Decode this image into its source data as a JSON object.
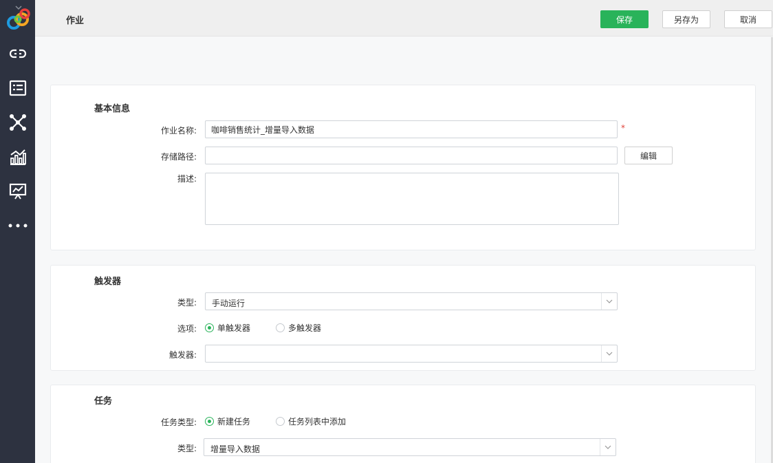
{
  "sidebar": {
    "logo": "app-logo",
    "items": [
      {
        "icon": "link-icon"
      },
      {
        "icon": "list-icon"
      },
      {
        "icon": "network-icon"
      },
      {
        "icon": "chart-icon"
      },
      {
        "icon": "presentation-icon"
      },
      {
        "icon": "more-icon"
      }
    ]
  },
  "header": {
    "title": "作业",
    "save_label": "保存",
    "save_as_label": "另存为",
    "cancel_label": "取消"
  },
  "basic": {
    "title": "基本信息",
    "name_label": "作业名称:",
    "name_value": "咖啡销售统计_增量导入数据",
    "required_mark": "*",
    "path_label": "存储路径:",
    "path_value": "",
    "edit_label": "编辑",
    "desc_label": "描述:"
  },
  "trigger": {
    "title": "触发器",
    "type_label": "类型:",
    "type_value": "手动运行",
    "option_label": "选项:",
    "option_single": "单触发器",
    "option_multi": "多触发器",
    "selected_option": "single",
    "trigger_label": "触发器:",
    "trigger_value": ""
  },
  "task": {
    "title": "任务",
    "task_type_label": "任务类型:",
    "task_type_new": "新建任务",
    "task_type_from_list": "任务列表中添加",
    "selected_task_type": "new",
    "type_label": "类型:",
    "type_value": "增量导入数据"
  },
  "colors": {
    "accent": "#29b35a",
    "sidebar_bg": "#2d3240",
    "required": "#e0443b"
  }
}
